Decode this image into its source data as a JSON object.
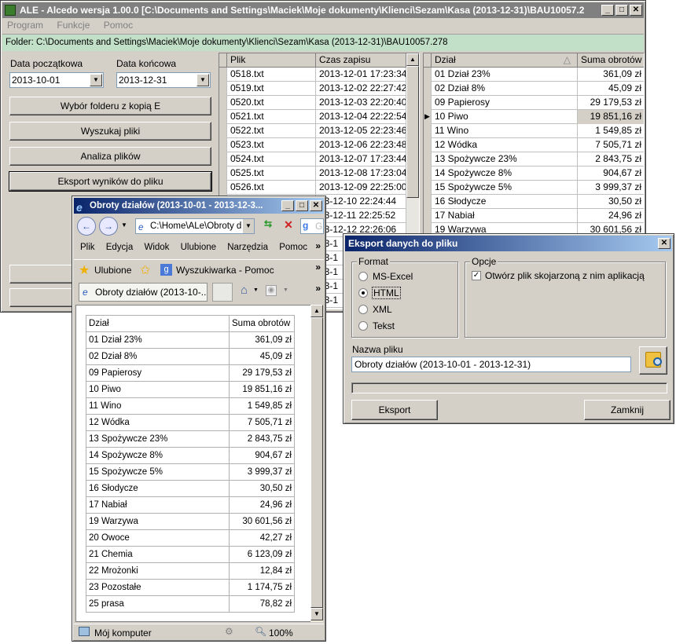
{
  "main": {
    "title": "ALE - Alcedo wersja 1.00.0 [C:\\Documents and Settings\\Maciek\\Moje dokumenty\\Klienci\\Sezam\\Kasa (2013-12-31)\\BAU10057.2",
    "menu": [
      "Program",
      "Funkcje",
      "Pomoc"
    ],
    "folder": "Folder: C:\\Documents and Settings\\Maciek\\Moje dokumenty\\Klienci\\Sezam\\Kasa (2013-12-31)\\BAU10057.278",
    "date_start_label": "Data początkowa",
    "date_start": "2013-10-01",
    "date_end_label": "Data końcowa",
    "date_end": "2013-12-31",
    "buttons": [
      "Wybór folderu z kopią E",
      "Wyszukaj pliki",
      "Analiza plików",
      "Eksport wyników do pliku"
    ],
    "files_headers": [
      "Plik",
      "Czas zapisu"
    ],
    "files": [
      [
        "0518.txt",
        "2013-12-01 17:23:34"
      ],
      [
        "0519.txt",
        "2013-12-02 22:27:42"
      ],
      [
        "0520.txt",
        "2013-12-03 22:20:40"
      ],
      [
        "0521.txt",
        "2013-12-04 22:22:54"
      ],
      [
        "0522.txt",
        "2013-12-05 22:23:46"
      ],
      [
        "0523.txt",
        "2013-12-06 22:23:48"
      ],
      [
        "0524.txt",
        "2013-12-07 17:23:44"
      ],
      [
        "0525.txt",
        "2013-12-08 17:23:04"
      ],
      [
        "0526.txt",
        "2013-12-09 22:25:00"
      ],
      [
        "",
        "13-12-10 22:24:44"
      ],
      [
        "",
        "13-12-11 22:25:52"
      ],
      [
        "",
        "13-12-12 22:26:06"
      ],
      [
        "",
        "13-1"
      ],
      [
        "",
        "13-1"
      ],
      [
        "",
        "13-1"
      ],
      [
        "",
        "13-1"
      ],
      [
        "",
        "13-1"
      ]
    ],
    "dept_headers": [
      "Dział",
      "Suma obrotów"
    ],
    "depts": [
      [
        "01 Dział 23%",
        "361,09 zł"
      ],
      [
        "02 Dział 8%",
        "45,09 zł"
      ],
      [
        "09 Papierosy",
        "29 179,53 zł"
      ],
      [
        "10 Piwo",
        "19 851,16 zł"
      ],
      [
        "11 Wino",
        "1 549,85 zł"
      ],
      [
        "12 Wódka",
        "7 505,71 zł"
      ],
      [
        "13 Spożywcze 23%",
        "2 843,75 zł"
      ],
      [
        "14 Spożywcze 8%",
        "904,67 zł"
      ],
      [
        "15 Spożywcze 5%",
        "3 999,37 zł"
      ],
      [
        "16 Słodycze",
        "30,50 zł"
      ],
      [
        "17 Nabiał",
        "24,96 zł"
      ],
      [
        "19 Warzywa",
        "30 601,56 zł"
      ]
    ]
  },
  "browser": {
    "title": "Obroty działów (2013-10-01 - 2013-12-3...",
    "address": "C:\\Home\\ALe\\Obroty d",
    "search_hint": "G",
    "menu": [
      "Plik",
      "Edycja",
      "Widok",
      "Ulubione",
      "Narzędzia",
      "Pomoc"
    ],
    "favorites": "Ulubione",
    "search_link": "Wyszukiwarka - Pomoc",
    "tab": "Obroty działów (2013-10-...",
    "table_headers": [
      "Dział",
      "Suma obrotów"
    ],
    "rows": [
      [
        "01 Dział 23%",
        "361,09 zł"
      ],
      [
        "02 Dział 8%",
        "45,09 zł"
      ],
      [
        "09 Papierosy",
        "29 179,53 zł"
      ],
      [
        "10 Piwo",
        "19 851,16 zł"
      ],
      [
        "11 Wino",
        "1 549,85 zł"
      ],
      [
        "12 Wódka",
        "7 505,71 zł"
      ],
      [
        "13 Spożywcze 23%",
        "2 843,75 zł"
      ],
      [
        "14 Spożywcze 8%",
        "904,67 zł"
      ],
      [
        "15 Spożywcze 5%",
        "3 999,37 zł"
      ],
      [
        "16 Słodycze",
        "30,50 zł"
      ],
      [
        "17 Nabiał",
        "24,96 zł"
      ],
      [
        "19 Warzywa",
        "30 601,56 zł"
      ],
      [
        "20 Owoce",
        "42,27 zł"
      ],
      [
        "21 Chemia",
        "6 123,09 zł"
      ],
      [
        "22 Mrożonki",
        "12,84 zł"
      ],
      [
        "23 Pozostałe",
        "1 174,75 zł"
      ],
      [
        "25 prasa",
        "78,82 zł"
      ]
    ],
    "status": "Mój komputer",
    "zoom": "100%"
  },
  "export": {
    "title": "Eksport danych do pliku",
    "format_label": "Format",
    "formats": [
      "MS-Excel",
      "HTML",
      "XML",
      "Tekst"
    ],
    "selected_format": "HTML",
    "options_label": "Opcje",
    "open_option": "Otwórz plik skojarzoną z nim aplikacją",
    "filename_label": "Nazwa pliku",
    "filename": "Obroty działów (2013-10-01 - 2013-12-31)",
    "export_button": "Eksport",
    "close_button": "Zamknij"
  }
}
